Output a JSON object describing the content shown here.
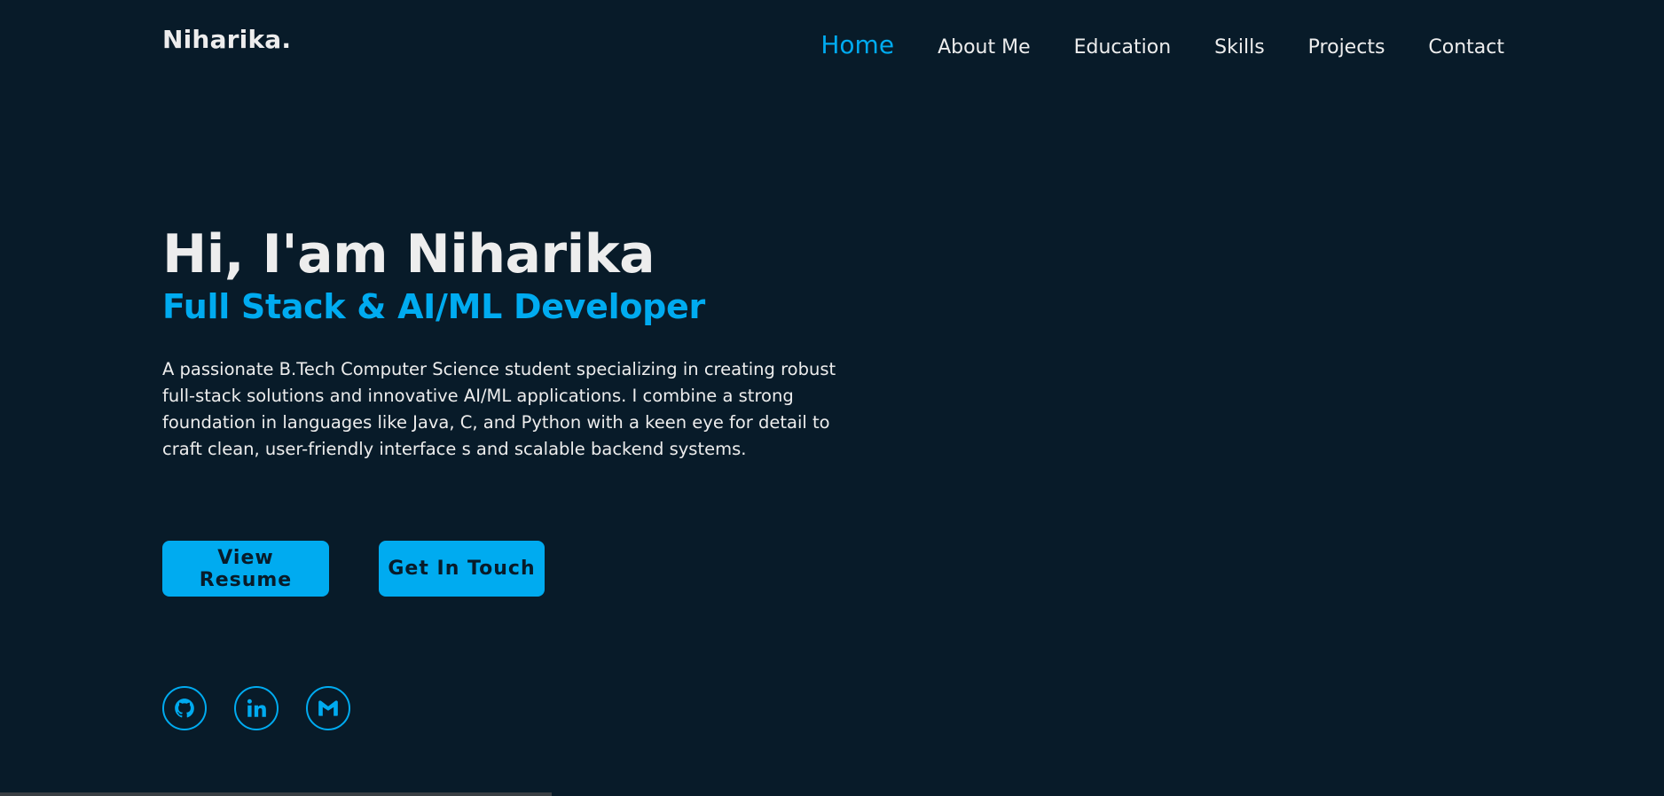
{
  "header": {
    "logo": "Niharika.",
    "nav": [
      {
        "label": "Home",
        "active": true
      },
      {
        "label": "About Me",
        "active": false
      },
      {
        "label": "Education",
        "active": false
      },
      {
        "label": "Skills",
        "active": false
      },
      {
        "label": "Projects",
        "active": false
      },
      {
        "label": "Contact",
        "active": false
      }
    ]
  },
  "hero": {
    "greeting": "Hi, I'am Niharika",
    "role": "Full Stack & AI/ML Developer",
    "description": "A passionate B.Tech Computer Science student specializing in creating robust full-stack solutions and innovative AI/ML applications. I combine a strong foundation in languages like Java, C, and Python with a keen eye for detail to craft clean, user-friendly interface s and scalable backend systems."
  },
  "buttons": {
    "resume_label": "View Resume",
    "touch_label": "Get In Touch"
  },
  "social": [
    {
      "icon": "github-icon"
    },
    {
      "icon": "linkedin-icon"
    },
    {
      "icon": "gmail-icon"
    }
  ],
  "colors": {
    "background": "#081b29",
    "accent": "#00abf0",
    "text": "#ededed"
  }
}
